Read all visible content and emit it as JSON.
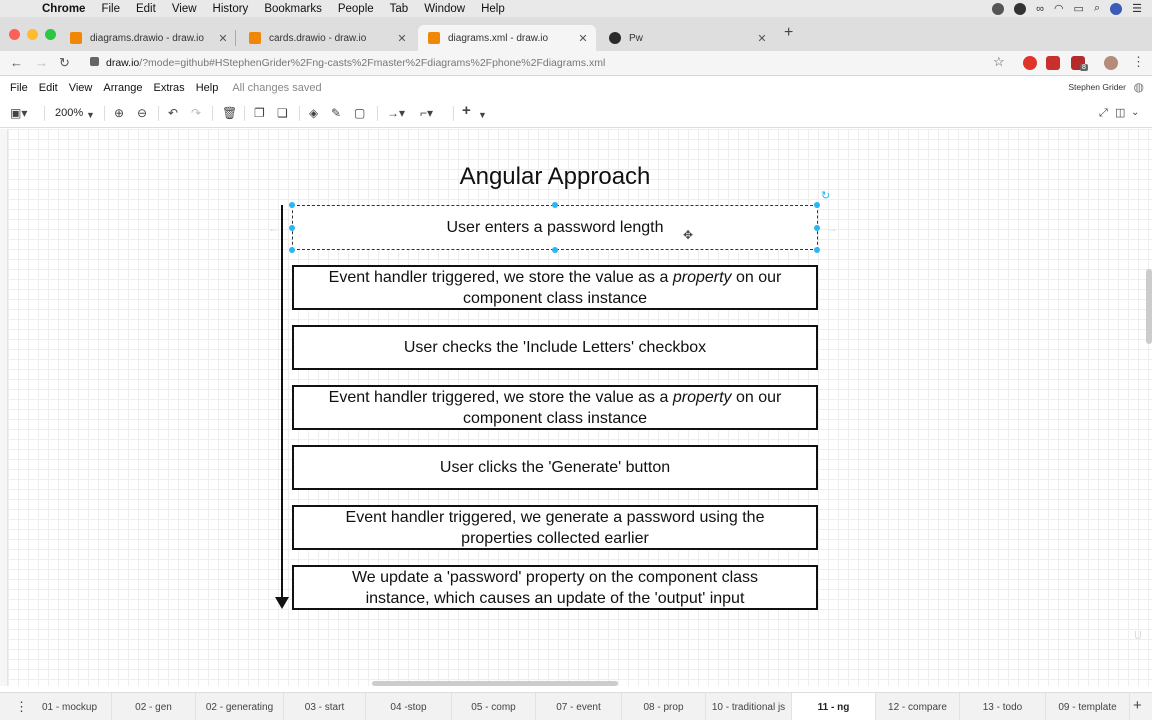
{
  "os_menu": {
    "app": "Chrome",
    "items": [
      "File",
      "Edit",
      "View",
      "History",
      "Bookmarks",
      "People",
      "Tab",
      "Window",
      "Help"
    ]
  },
  "browser": {
    "tabs": [
      {
        "title": "diagrams.drawio - draw.io",
        "active": false,
        "icon": "drawio-favicon"
      },
      {
        "title": "cards.drawio - draw.io",
        "active": false,
        "icon": "drawio-favicon"
      },
      {
        "title": "diagrams.xml - draw.io",
        "active": true,
        "icon": "drawio-favicon"
      },
      {
        "title": "Pw",
        "active": false,
        "icon": "angular-favicon"
      }
    ],
    "url_host": "draw.io",
    "url_path": "/?mode=github#HStephenGrider%2Fng-casts%2Fmaster%2Fdiagrams%2Fphone%2Fdiagrams.xml",
    "extension_badge": "8"
  },
  "app_menu": {
    "items": [
      "File",
      "Edit",
      "View",
      "Arrange",
      "Extras",
      "Help"
    ],
    "status": "All changes saved",
    "user": "Stephen Grider"
  },
  "toolbar": {
    "zoom": "200%"
  },
  "diagram": {
    "title": "Angular Approach",
    "boxes": [
      {
        "line1": "User enters a password length",
        "line2": "",
        "emphasis": ""
      },
      {
        "line1_pre": "Event handler triggered, we store the value as a ",
        "emphasis": "property",
        "line1_post": " on our",
        "line2": "component class instance"
      },
      {
        "line1": "User checks the 'Include Letters' checkbox",
        "line2": "",
        "emphasis": ""
      },
      {
        "line1_pre": "Event handler triggered, we store the value as a ",
        "emphasis": "property",
        "line1_post": " on our",
        "line2": "component class instance"
      },
      {
        "line1": "User clicks the 'Generate' button",
        "line2": "",
        "emphasis": ""
      },
      {
        "line1": "Event handler triggered, we generate a password using the",
        "line2": "properties collected earlier",
        "emphasis": ""
      },
      {
        "line1": "We update a 'password' property on the component class",
        "line2": "instance, which causes an update of the 'output' input",
        "emphasis": ""
      }
    ]
  },
  "page_tabs": [
    {
      "label": "01 - mockup",
      "active": false
    },
    {
      "label": "02 - gen",
      "active": false
    },
    {
      "label": "02 - generating",
      "active": false
    },
    {
      "label": "03 - start",
      "active": false
    },
    {
      "label": "04 -stop",
      "active": false
    },
    {
      "label": "05 - comp",
      "active": false
    },
    {
      "label": "07 - event",
      "active": false
    },
    {
      "label": "08 - prop",
      "active": false
    },
    {
      "label": "10 - traditional js",
      "active": false
    },
    {
      "label": "11 - ng",
      "active": true
    },
    {
      "label": "12 - compare",
      "active": false
    },
    {
      "label": "13 - todo",
      "active": false
    },
    {
      "label": "09 - template",
      "active": false
    }
  ],
  "colors": {
    "selection": "#29b6f2",
    "drawio_orange": "#f08705",
    "close_red": "#fe5f57",
    "minimize_yellow": "#febc2e",
    "zoom_green": "#28c840"
  }
}
